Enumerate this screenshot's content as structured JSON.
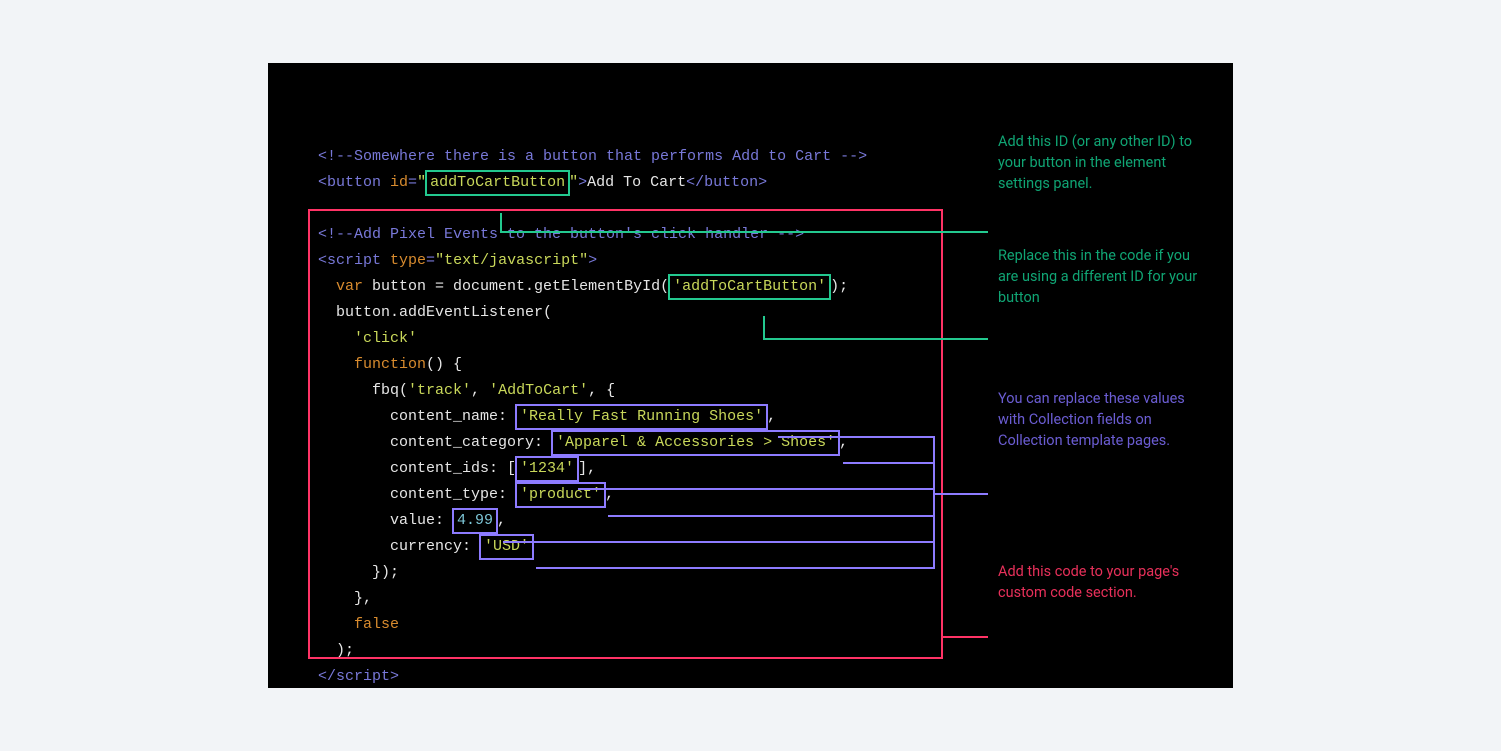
{
  "code": {
    "comment1": "<!--Somewhere there is a button that performs Add to Cart -->",
    "button_open1": "<button",
    "button_attr_id": "id",
    "button_eq": "=",
    "button_id_q1": "\"",
    "button_id_val": "addToCartButton",
    "button_id_q2": "\"",
    "button_close_gt": ">",
    "button_text": "Add To Cart",
    "button_close": "</button>",
    "comment2": "<!--Add Pixel Events to the button's click handler -->",
    "script_open": "<script",
    "script_attr_type": "type",
    "script_type_val": "\"text/javascript\"",
    "script_gt": ">",
    "kw_var": "var",
    "line_var_a": " button = document.getElementById(",
    "geid_q1": "'",
    "geid_val": "addToCartButton",
    "geid_q2": "'",
    "line_var_b": ");",
    "line_add": "  button.addEventListener(",
    "click_str": "'click'",
    "kw_function": "function",
    "func_suffix": "() {",
    "fbq_a": "fbq(",
    "track_str": "'track'",
    "comma_sp": ", ",
    "addtocart_str": "'AddToCart'",
    "obj_open": ", {",
    "content_name_label": "content_name: ",
    "content_name_val": "'Really Fast Running Shoes'",
    "content_category_label": "content_category: ",
    "content_category_val": "'Apparel & Accessories > Shoes'",
    "content_ids_label": "content_ids: [",
    "content_ids_val": "'1234'",
    "content_ids_close": "],",
    "content_type_label": "content_type: ",
    "content_type_val": "'product'",
    "value_label": "value: ",
    "value_val": "4.99",
    "currency_label": "currency: ",
    "currency_val": "'USD'",
    "obj_close": "});",
    "brace_close_comma": "},",
    "kw_false": "false",
    "paren_close": ");",
    "script_close": "</script>",
    "comma": ","
  },
  "annotations": {
    "a1": "Add this ID (or any other ID) to your button in the element settings panel.",
    "a2": "Replace this in the code if you are using a different ID for your button",
    "a3": "You can replace these values with Collection fields on Collection template pages.",
    "a4": "Add this code to your page's custom code section."
  }
}
